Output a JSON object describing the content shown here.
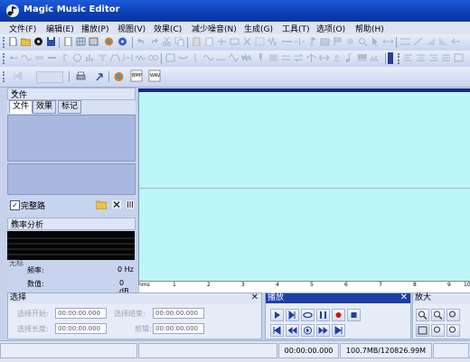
{
  "window": {
    "title": "Magic Music Editor"
  },
  "menu": [
    "文件(F)",
    "编辑(E)",
    "播放(P)",
    "视图(V)",
    "效果(C)",
    "减少噪音(N)",
    "生成(G)",
    "工具(T)",
    "选项(O)",
    "帮助(H)"
  ],
  "file_panel": {
    "title": "文件",
    "tabs": [
      "文件",
      "效果",
      "标记"
    ],
    "full_path_label": "完整路",
    "full_path_checked": true
  },
  "freq_panel": {
    "title": "频率分析",
    "freq_label": "频率:",
    "freq_value": "0 Hz",
    "value_label": "数值:",
    "value_value": "0 dB",
    "partial_label": "无标"
  },
  "ruler": {
    "unit": "hms",
    "ticks": [
      "1",
      "2",
      "3",
      "4",
      "5",
      "6",
      "7",
      "8",
      "9",
      "10"
    ]
  },
  "selection_panel": {
    "title": "选择",
    "start_label": "选择开始:",
    "start_value": "00:00:00.000",
    "end_label": "选择结束:",
    "end_value": "00:00:00.000",
    "length_label": "选择长度:",
    "length_value": "00:00:00.000",
    "clip_label": "剪辑:",
    "clip_value": "00:00:00.000"
  },
  "play_panel": {
    "title": "播放"
  },
  "zoom_panel": {
    "title": "放大"
  },
  "status": {
    "time": "00:00:00.000",
    "memory": "100.7MB/120826.99M"
  },
  "colors": {
    "waveform_bg": "#bdf6f7",
    "titlebar": "#0b3eb5",
    "record": "#d01414"
  }
}
